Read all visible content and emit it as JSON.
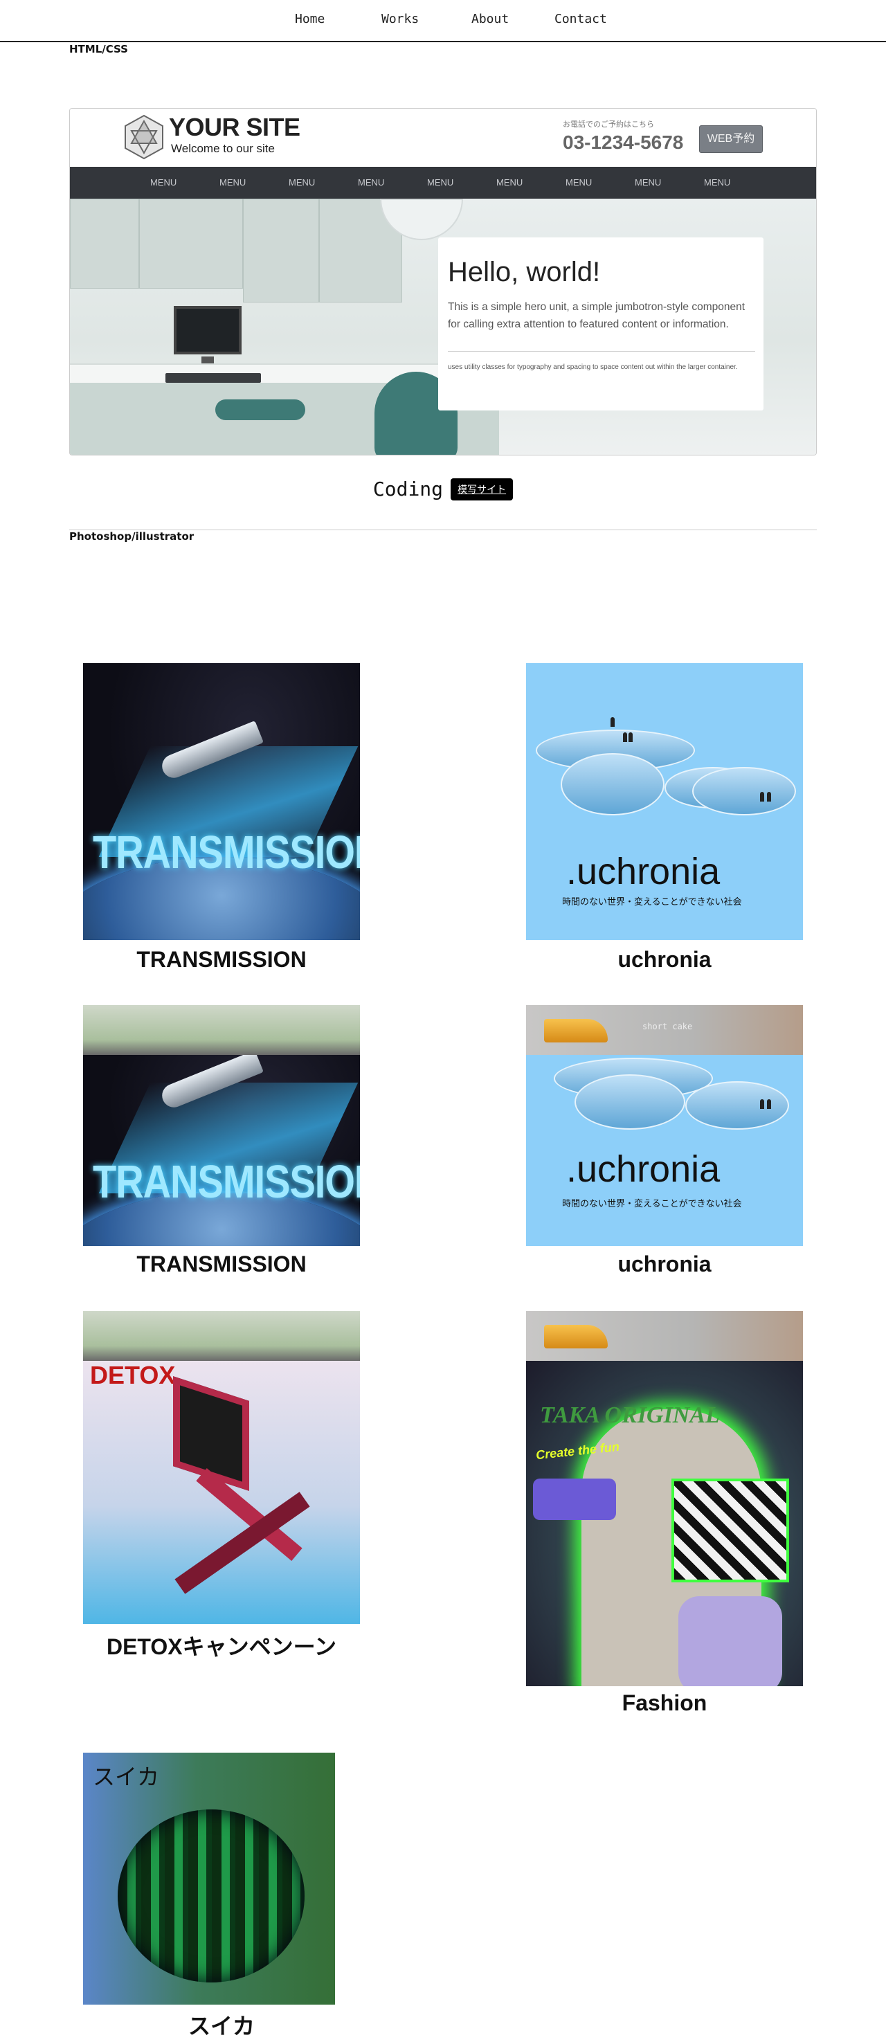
{
  "nav": {
    "items": [
      "Home",
      "Works",
      "About",
      "Contact"
    ]
  },
  "sections": {
    "html_css": "HTML/CSS",
    "photoshop": "Photoshop/illustrator"
  },
  "mock_site": {
    "site_name": "YOUR SITE",
    "tagline": "Welcome to our site",
    "phone_label": "お電話でのご予約はこちら",
    "phone": "03-1234-5678",
    "reserve_button": "WEB予約",
    "menu_items": [
      "MENU",
      "MENU",
      "MENU",
      "MENU",
      "MENU",
      "MENU",
      "MENU",
      "MENU",
      "MENU"
    ],
    "hero": {
      "title": "Hello, world!",
      "lead": "This is a simple hero unit, a simple jumbotron-style component for calling extra attention to featured content or information.",
      "small": "uses utility classes for typography and spacing to space content out within the larger container."
    }
  },
  "coding": {
    "label": "Coding",
    "button": "模写サイト"
  },
  "works": [
    {
      "caption": "TRANSMISSION",
      "art_text": "TRANSMISSION"
    },
    {
      "caption": "uchronia",
      "art_text": ".uchronia",
      "art_sub": "時間のない世界・変えることができない社会"
    },
    {
      "caption": "TRANSMISSION",
      "art_text": "TRANSMISSION"
    },
    {
      "caption": "uchronia",
      "art_text": ".uchronia",
      "art_sub": "時間のない世界・変えることができない社会",
      "strip_text": "short cake"
    },
    {
      "caption": "DETOXキャンペンーン",
      "art_text": "DETOX"
    },
    {
      "caption": "Fashion",
      "art_text": "TAKA ORIGINAL",
      "art_sub": "Create the fun"
    },
    {
      "caption": "スイカ",
      "art_text": "スイカ"
    }
  ]
}
